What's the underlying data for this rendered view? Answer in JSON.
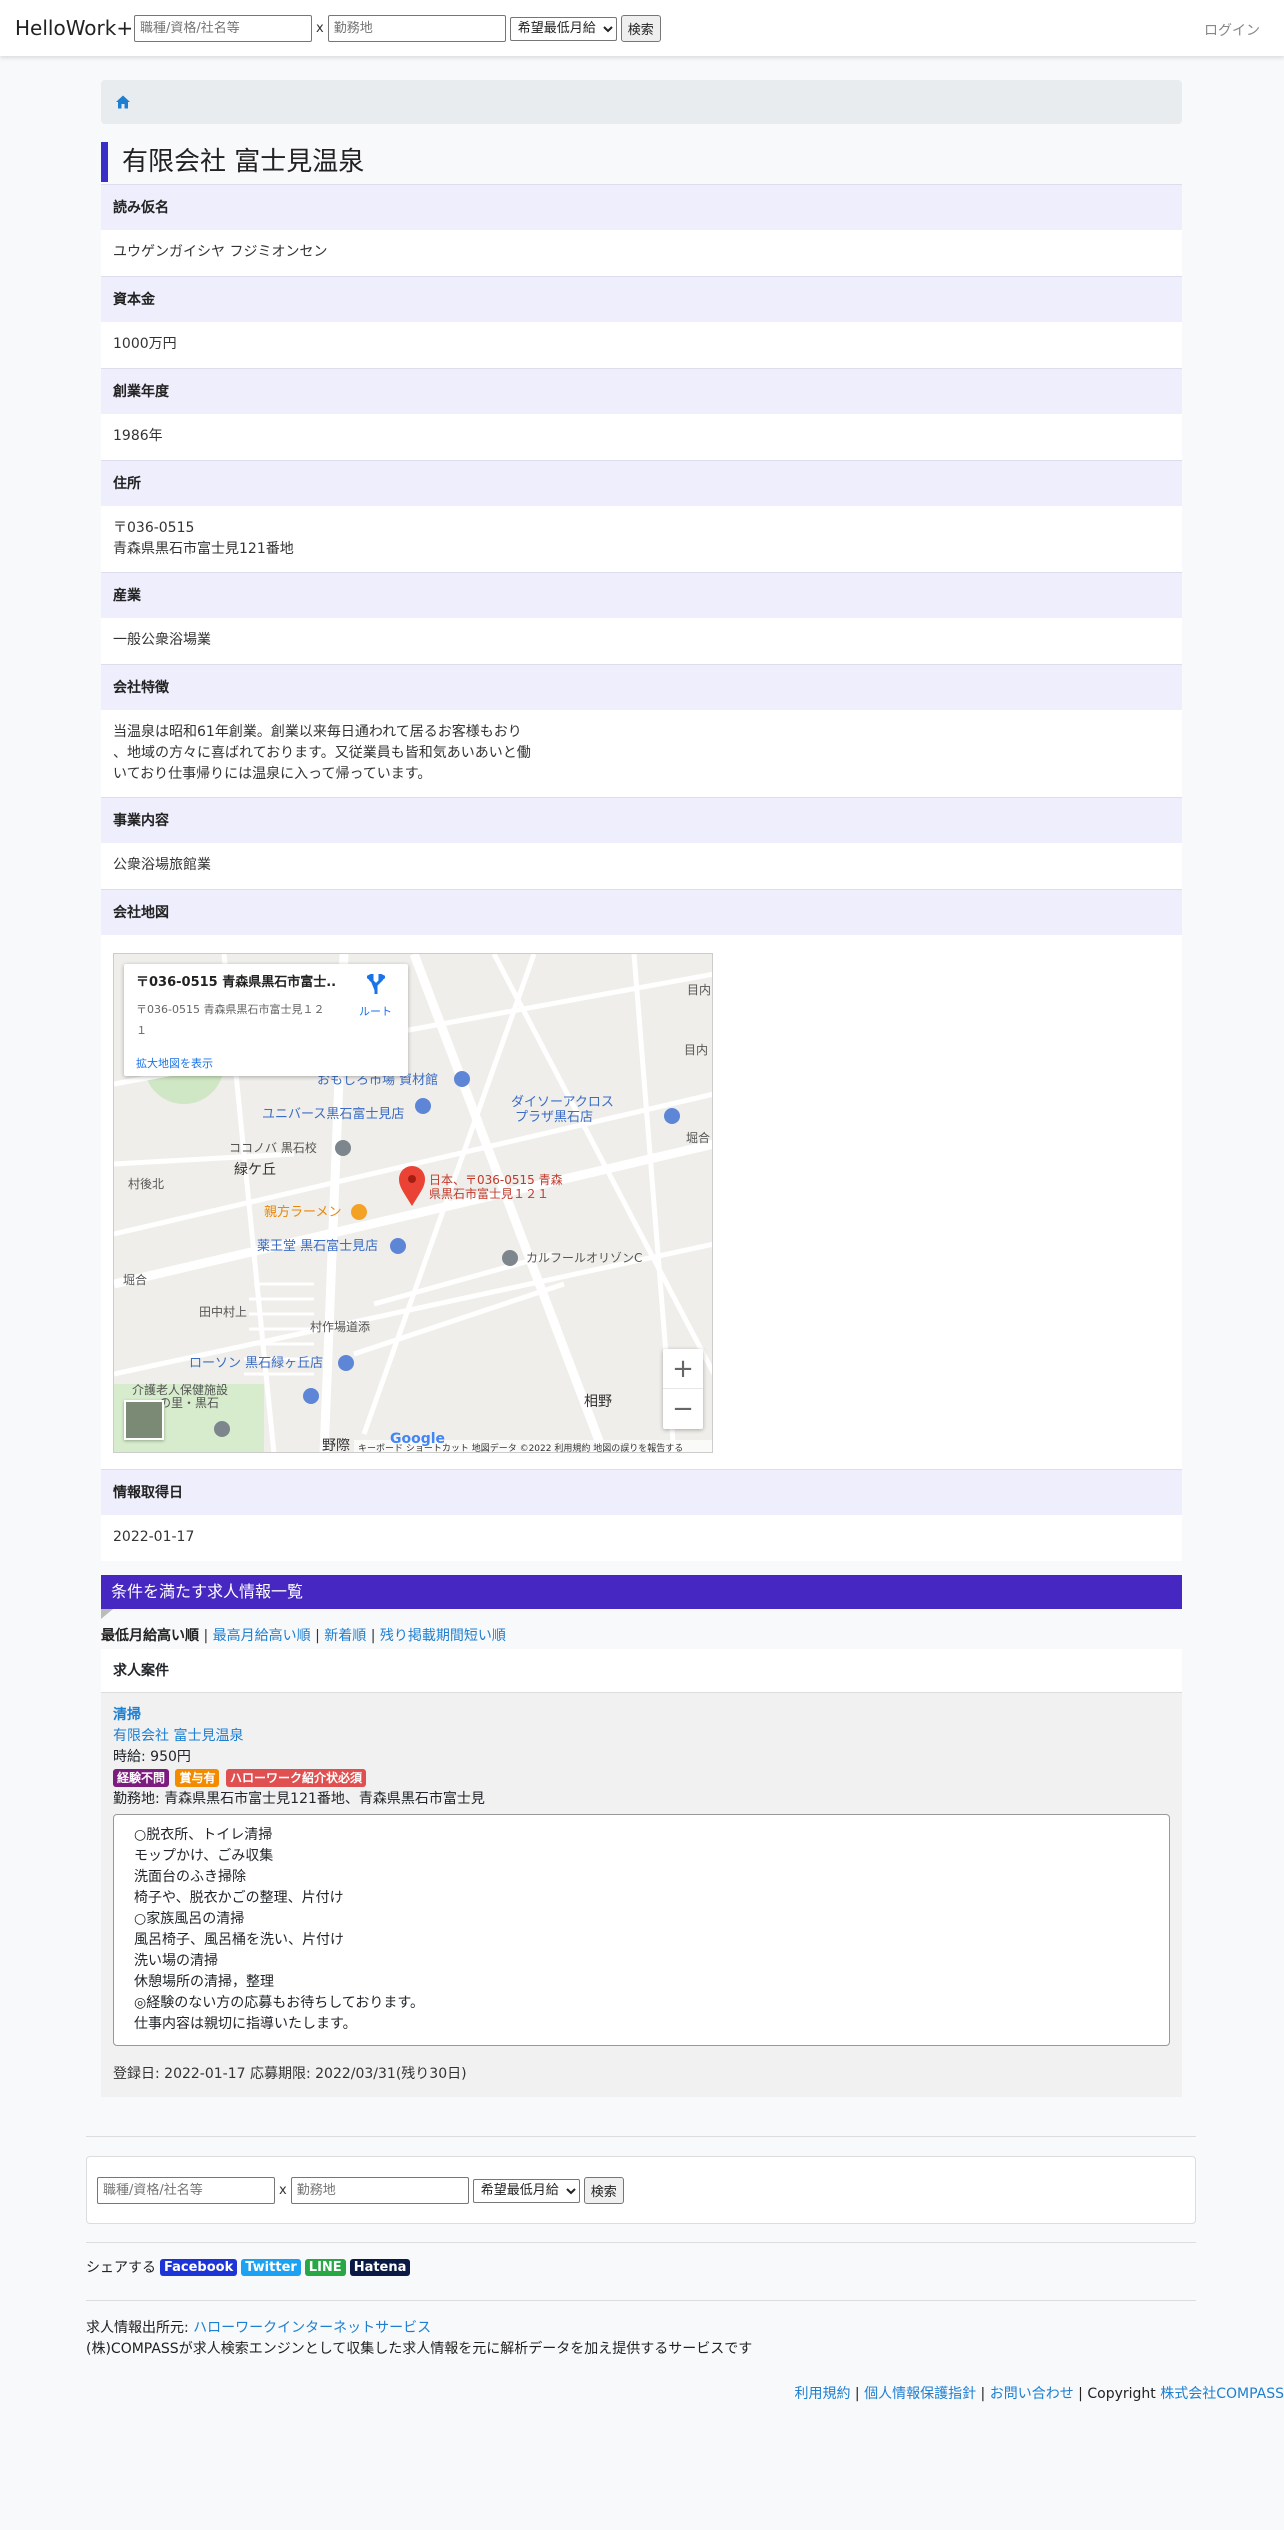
{
  "nav": {
    "brand": "HelloWork+",
    "search_placeholder": "職種/資格/社名等",
    "x_sep": "x",
    "location_placeholder": "勤務地",
    "salary_option": "希望最低月給",
    "search_button": "検索",
    "login": "ログイン"
  },
  "company": {
    "name": "有限会社 富士見温泉",
    "rows": [
      {
        "label": "読み仮名",
        "value": "ユウゲンガイシヤ フジミオンセン"
      },
      {
        "label": "資本金",
        "value": "1000万円"
      },
      {
        "label": "創業年度",
        "value": "1986年"
      },
      {
        "label": "住所",
        "value": "〒036-0515\n青森県黒石市富士見121番地"
      },
      {
        "label": "産業",
        "value": "一般公衆浴場業"
      },
      {
        "label": "会社特徴",
        "value": "当温泉は昭和61年創業。創業以来毎日通われて居るお客様もおり\n、地域の方々に喜ばれております。又従業員も皆和気あいあいと働\nいており仕事帰りには温泉に入って帰っています。"
      },
      {
        "label": "事業内容",
        "value": "公衆浴場旅館業"
      }
    ],
    "map_label": "会社地図",
    "date_label": "情報取得日",
    "date_value": "2022-01-17"
  },
  "map": {
    "popup_title": "〒036-0515 青森県黒石市富士...",
    "popup_addr_1": "〒036-0515 青森県黒石市富士見１２",
    "popup_addr_2": "１",
    "popup_link": "拡大地図を表示",
    "route": "ルート",
    "marker_label_1": "日本、〒036-0515 青森",
    "marker_label_2": "県黒石市富士見１２１",
    "places": {
      "omoshiro": "おもしろ市場 資材館",
      "unibers": "ユニバース黒石富士見店",
      "daiso_1": "ダイソーアクロス",
      "daiso_2": "プラザ黒石店",
      "kokonoba": "ココノバ 黒石校",
      "midorigaoka": "緑ケ丘",
      "sonkobuki": "村後北",
      "oyakata": "親方ラーメン",
      "yakuodo": "薬王堂 黒石富士見店",
      "carrefour": "カルフールオリゾンC",
      "horiai_left": "堀合",
      "horiai_right": "堀合",
      "tanaka": "田中村上",
      "sonkoba": "村作場道添",
      "lawson": "ローソン 黒石緑ヶ丘店",
      "kaigo_1": "介護老人保健施設",
      "kaigo_2": "の里・黒石",
      "aino": "相野",
      "nogiwa": "野際",
      "menai_1": "目内",
      "menai_2": "目内"
    },
    "footer": "キーボード ショートカット   地図データ ©2022    利用規約    地図の誤りを報告する",
    "google": "Google",
    "zoom_in": "+",
    "zoom_out": "−"
  },
  "jobs": {
    "banner": "条件を満たす求人情報一覧",
    "sort_active": "最低月給高い順",
    "sort_links": [
      "最高月給高い順",
      "新着順",
      "残り掲載期間短い順"
    ],
    "card_header": "求人案件",
    "job_title": "清掃",
    "company_link": "有限会社 富士見温泉",
    "wage": "時給: 950円",
    "badges": [
      {
        "text": "経験不問",
        "color": "#7b1c7e"
      },
      {
        "text": "賞与有",
        "color": "#f28b00"
      },
      {
        "text": "ハローワーク紹介状必須",
        "color": "#e05050"
      }
    ],
    "location": "勤務地: 青森県黒石市富士見121番地、青森県黒石市富士見",
    "description": "○脱衣所、トイレ清掃\nモップかけ、ごみ収集\n洗面台のふき掃除\n椅子や、脱衣かごの整理、片付け\n○家族風呂の清掃\n風呂椅子、風呂桶を洗い、片付け\n洗い場の清掃\n休憩場所の清掃，整理\n◎経験のない方の応募もお待ちしております。\n仕事内容は親切に指導いたします。",
    "dates": "登録日: 2022-01-17 応募期限: 2022/03/31(残り30日)"
  },
  "share": {
    "label": "シェアする",
    "facebook": "Facebook",
    "twitter": "Twitter",
    "line": "LINE",
    "hatena": "Hatena"
  },
  "footer": {
    "source_label": "求人情報出所元: ",
    "source_link": "ハローワークインターネットサービス",
    "about": "(株)COMPASSが求人検索エンジンとして収集した求人情報を元に解析データを加え提供するサービスです",
    "terms": "利用規約",
    "privacy": "個人情報保護指針",
    "contact": "お問い合わせ",
    "copyright": "Copyright ",
    "company": "株式会社COMPASS"
  }
}
